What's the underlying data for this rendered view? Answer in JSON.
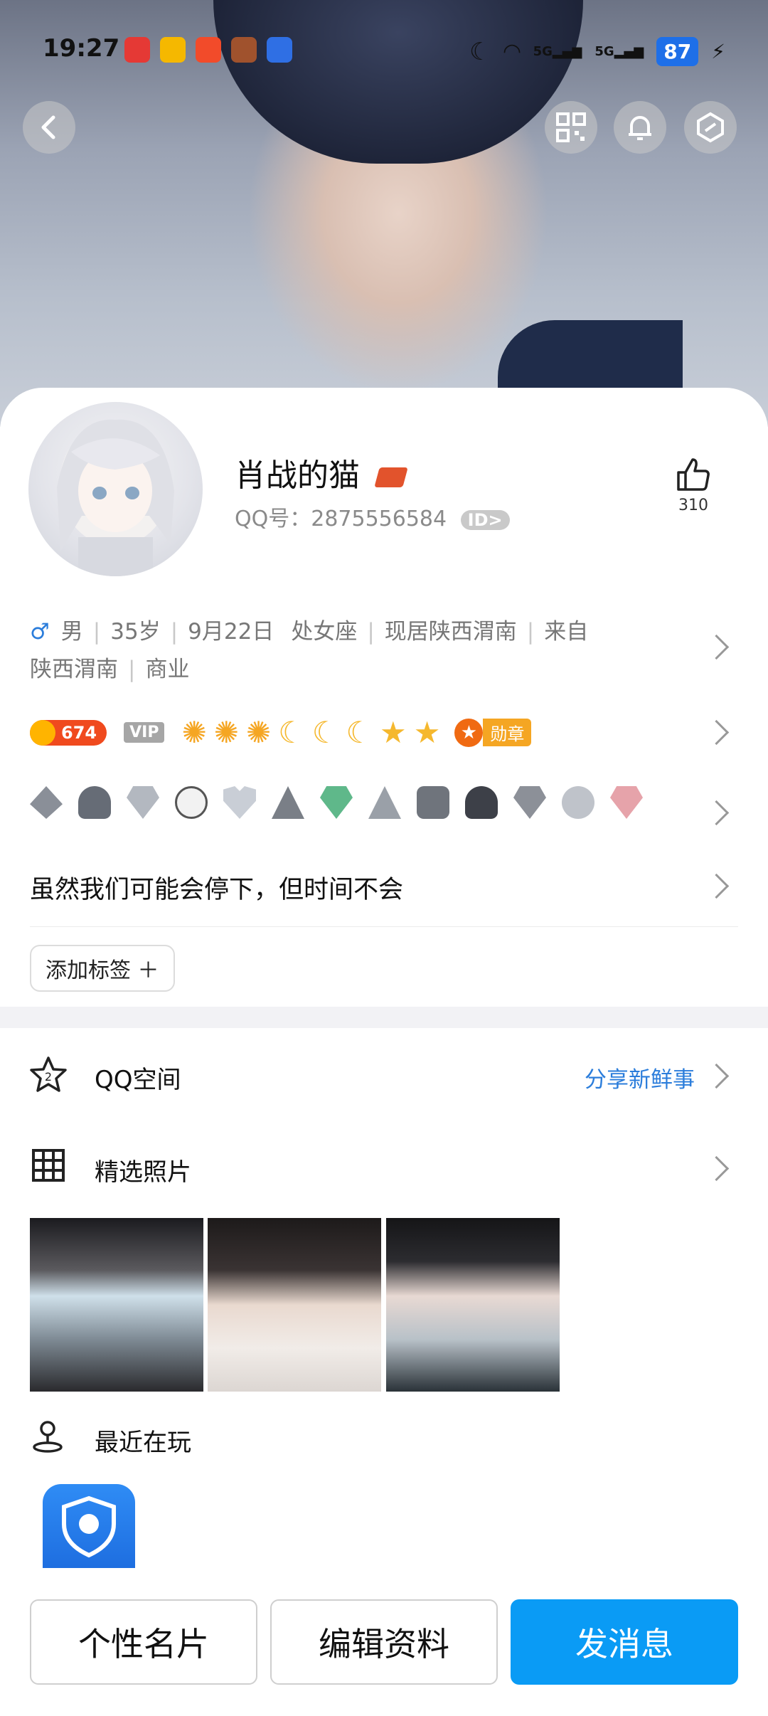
{
  "status_bar": {
    "time": "19:27",
    "battery": "87",
    "net1": "5G",
    "net2": "5G"
  },
  "profile": {
    "name": "肖战的猫",
    "qq_label": "QQ号：2875556584",
    "id_badge": "ID>",
    "likes": "310",
    "gender_symbol": "♂",
    "info_line1": [
      "男",
      "35岁",
      "9月22日",
      "处女座",
      "现居陕西渭南",
      "来自"
    ],
    "info_line2": [
      "陕西渭南",
      "商业"
    ],
    "level_coins": "674",
    "vip_label": "VIP",
    "medal_label": "勋章",
    "signature": "虽然我们可能会停下，但时间不会",
    "add_tag": "添加标签 ＋"
  },
  "sections": {
    "qzone": {
      "title": "QQ空间",
      "action": "分享新鲜事"
    },
    "photos": {
      "title": "精选照片"
    },
    "recent": {
      "title": "最近在玩"
    }
  },
  "buttons": {
    "card": "个性名片",
    "edit": "编辑资料",
    "message": "发消息"
  },
  "colors": {
    "accent": "#0a9bf5",
    "link": "#2b7ddb"
  },
  "icons": [
    "back-icon",
    "qr-code-icon",
    "bell-icon",
    "hexagon-settings-icon",
    "thumbs-up-icon",
    "star-badge-icon",
    "grid-icon",
    "location-person-icon"
  ]
}
